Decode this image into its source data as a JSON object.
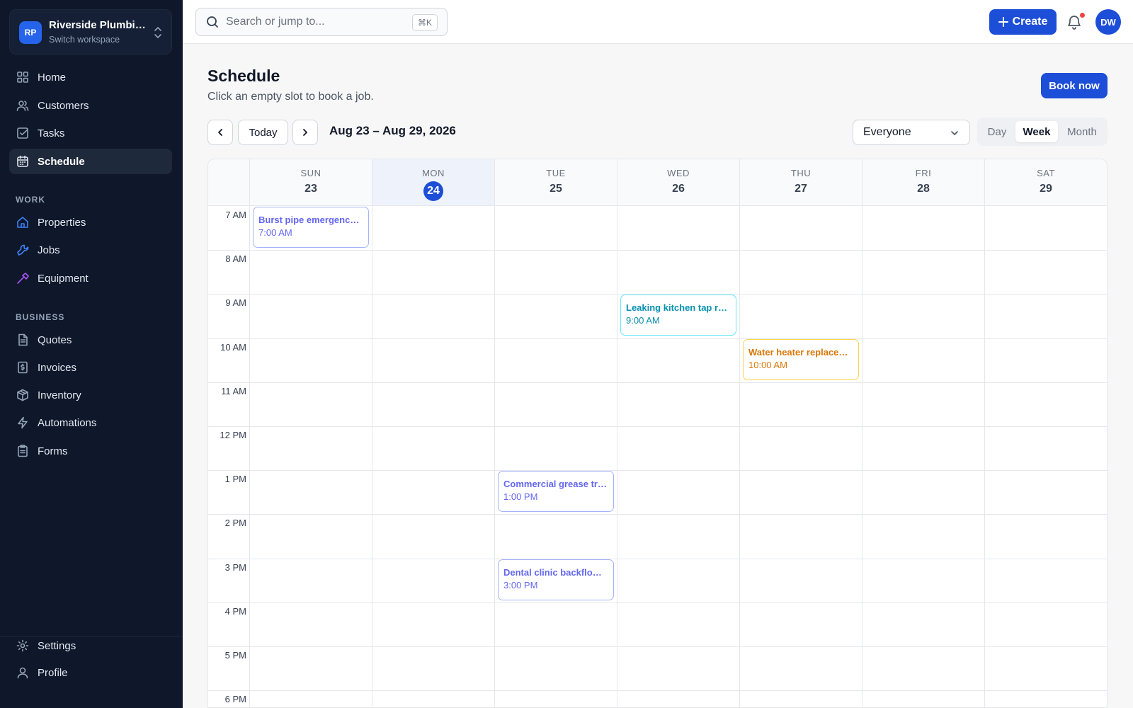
{
  "workspace": {
    "initials": "RP",
    "name": "Riverside Plumbing",
    "subtitle": "Switch workspace"
  },
  "sidebar": {
    "main": [
      {
        "label": "Home",
        "icon": "grid-icon"
      },
      {
        "label": "Customers",
        "icon": "users-icon"
      },
      {
        "label": "Tasks",
        "icon": "checkbox-icon"
      },
      {
        "label": "Schedule",
        "icon": "calendar-icon",
        "active": true
      }
    ],
    "work_label": "WORK",
    "work": [
      {
        "label": "Properties",
        "icon": "home-icon"
      },
      {
        "label": "Jobs",
        "icon": "wrench-icon"
      },
      {
        "label": "Equipment",
        "icon": "hammer-icon"
      }
    ],
    "business_label": "BUSINESS",
    "business": [
      {
        "label": "Quotes",
        "icon": "document-icon"
      },
      {
        "label": "Invoices",
        "icon": "invoice-icon"
      },
      {
        "label": "Inventory",
        "icon": "box-icon"
      },
      {
        "label": "Automations",
        "icon": "bolt-icon"
      },
      {
        "label": "Forms",
        "icon": "clipboard-icon"
      }
    ],
    "bottom": [
      {
        "label": "Settings",
        "icon": "gear-icon"
      },
      {
        "label": "Profile",
        "icon": "user-icon"
      }
    ]
  },
  "topbar": {
    "search_placeholder": "Search or jump to...",
    "shortcut": "⌘K",
    "create_label": "Create",
    "user_initials": "DW"
  },
  "page": {
    "title": "Schedule",
    "subtitle": "Click an empty slot to book a job.",
    "book_label": "Book now",
    "today_label": "Today",
    "range": "Aug 23 – Aug 29, 2026",
    "filter_value": "Everyone",
    "views": [
      "Day",
      "Week",
      "Month"
    ],
    "active_view": "Week"
  },
  "calendar": {
    "days": [
      {
        "dow": "SUN",
        "num": "23"
      },
      {
        "dow": "MON",
        "num": "24",
        "today": true
      },
      {
        "dow": "TUE",
        "num": "25"
      },
      {
        "dow": "WED",
        "num": "26"
      },
      {
        "dow": "THU",
        "num": "27"
      },
      {
        "dow": "FRI",
        "num": "28"
      },
      {
        "dow": "SAT",
        "num": "29"
      }
    ],
    "hours": [
      "7 AM",
      "8 AM",
      "9 AM",
      "10 AM",
      "11 AM",
      "12 PM",
      "1 PM",
      "2 PM",
      "3 PM",
      "4 PM",
      "5 PM",
      "6 PM"
    ],
    "events": [
      {
        "title": "Burst pipe emergency repair",
        "time": "7:00 AM",
        "day": 0,
        "hour": 0,
        "color": "#6366f1",
        "border": "#a5b4fc"
      },
      {
        "title": "Leaking kitchen tap repair",
        "time": "9:00 AM",
        "day": 3,
        "hour": 2,
        "color": "#0891b2",
        "border": "#67e8f9"
      },
      {
        "title": "Water heater replacement",
        "time": "10:00 AM",
        "day": 4,
        "hour": 3,
        "color": "#d97706",
        "border": "#fcd34d"
      },
      {
        "title": "Commercial grease trap cleaning",
        "time": "1:00 PM",
        "day": 2,
        "hour": 6,
        "color": "#6366f1",
        "border": "#a5b4fc"
      },
      {
        "title": "Dental clinic backflow test",
        "time": "3:00 PM",
        "day": 2,
        "hour": 8,
        "color": "#6366f1",
        "border": "#a5b4fc"
      }
    ]
  }
}
